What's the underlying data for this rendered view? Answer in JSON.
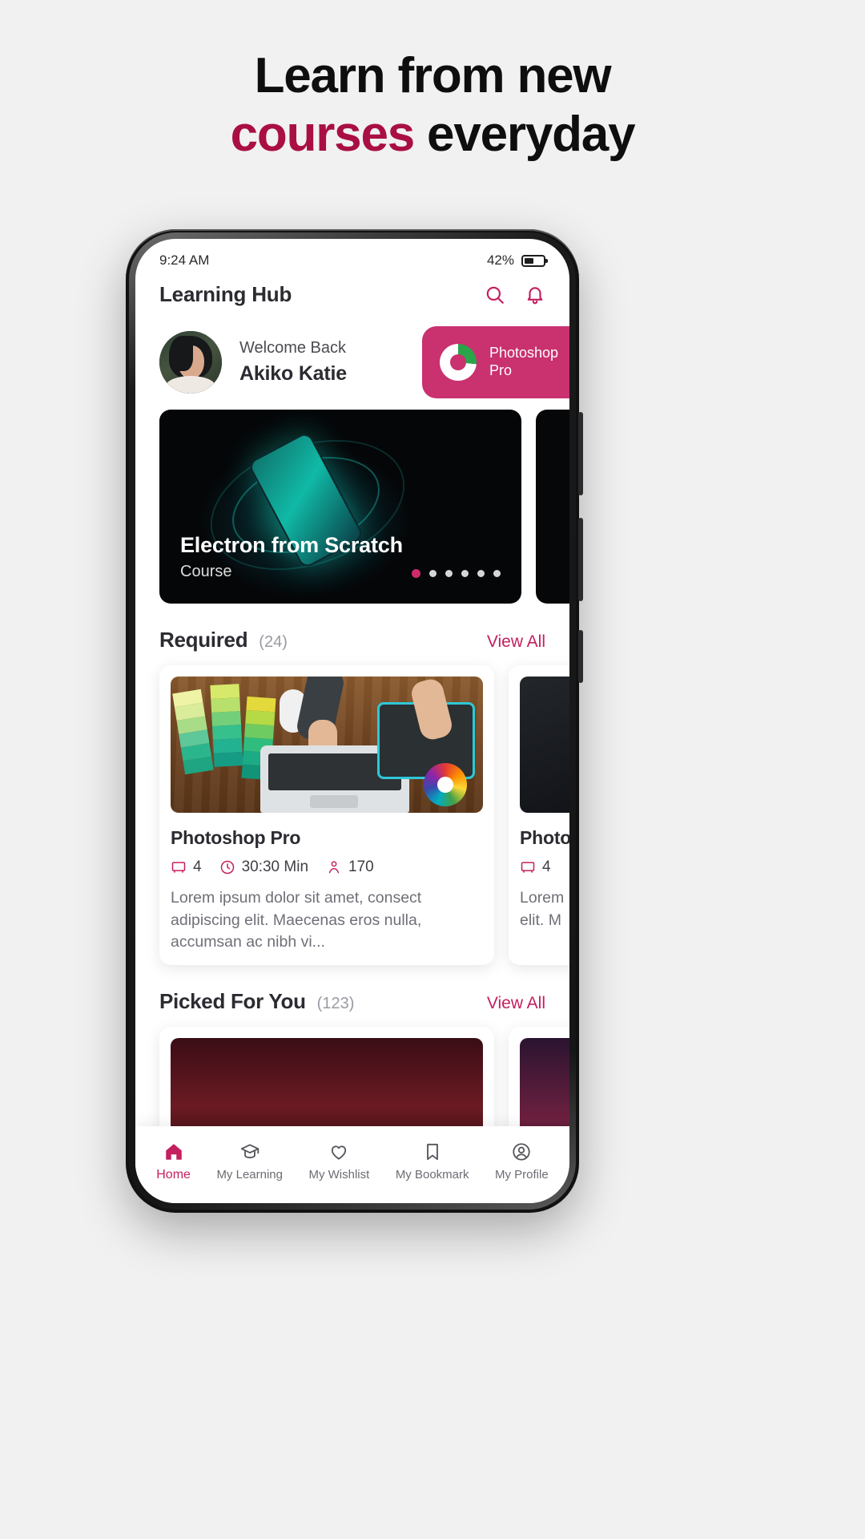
{
  "promo_headline": {
    "line1": "Learn from new",
    "accent_word": "courses",
    "line2_rest": " everyday",
    "accent_color": "#a90f44"
  },
  "status_bar": {
    "time": "9:24 AM",
    "battery_percent": "42%"
  },
  "app_bar": {
    "title": "Learning Hub",
    "search_icon": "search-icon",
    "bell_icon": "bell-icon"
  },
  "welcome": {
    "greeting": "Welcome Back",
    "user_name": "Akiko Katie",
    "avatar": "user-avatar",
    "promo_card": {
      "line1": "Photoshop",
      "line2": "Pro",
      "background_color": "#c9316f",
      "progress_color": "#2aa44a"
    }
  },
  "hero": {
    "title": "Electron from Scratch",
    "subtitle": "Course",
    "dots_total": 6,
    "dot_active_index": 0,
    "active_dot_color": "#d12a6c"
  },
  "sections": [
    {
      "title": "Required",
      "count": "(24)",
      "view_all": "View All",
      "cards": [
        {
          "title": "Photoshop Pro",
          "lessons": "4",
          "duration": "30:30 Min",
          "students": "170",
          "description": "Lorem ipsum dolor sit amet, consect adipiscing elit. Maecenas eros nulla, accumsan ac nibh vi...",
          "thumb": "design-desk-photo"
        },
        {
          "title": "Photo",
          "lessons": "4",
          "duration": "",
          "students": "",
          "description": "Lorem elit. M",
          "thumb": "dark-photo"
        }
      ]
    },
    {
      "title": "Picked For You",
      "count": "(123)",
      "view_all": "View All",
      "cards": [
        {
          "title": "",
          "thumb": "picked-photo-1"
        },
        {
          "title": "",
          "thumb": "picked-photo-2"
        }
      ]
    }
  ],
  "bottom_nav": {
    "items": [
      {
        "label": "Home",
        "icon": "home-icon",
        "active": true
      },
      {
        "label": "My Learning",
        "icon": "graduation-cap-icon",
        "active": false
      },
      {
        "label": "My Wishlist",
        "icon": "heart-icon",
        "active": false
      },
      {
        "label": "My Bookmark",
        "icon": "bookmark-icon",
        "active": false
      },
      {
        "label": "My Profile",
        "icon": "person-circle-icon",
        "active": false
      }
    ],
    "active_color": "#c41f5f"
  }
}
